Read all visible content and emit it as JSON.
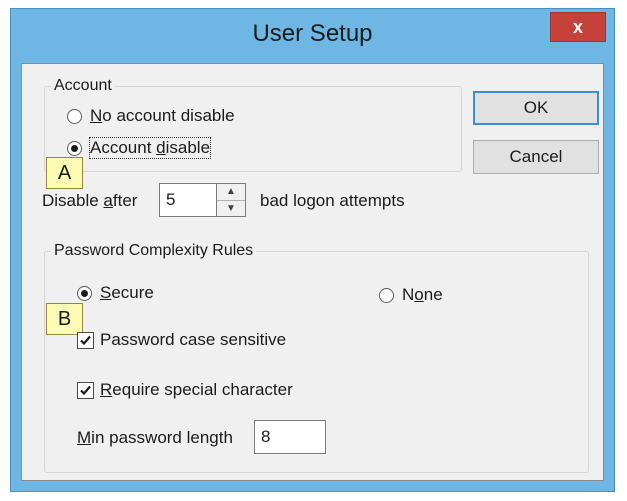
{
  "window": {
    "title": "User Setup",
    "close_glyph": "x"
  },
  "account": {
    "legend": "Account",
    "no_disable": {
      "mnemonic": "N",
      "rest": "o account disable",
      "selected": false
    },
    "disable": {
      "mnemonic": "",
      "pre": "Account ",
      "mn": "d",
      "rest": "isable",
      "selected": true
    },
    "disable_after_pre": "Disable ",
    "disable_after_mn": "a",
    "disable_after_rest": "fter",
    "attempts_value": "5",
    "attempts_suffix": "bad logon attempts"
  },
  "buttons": {
    "ok": "OK",
    "cancel": "Cancel"
  },
  "password": {
    "legend": "Password Complexity Rules",
    "secure": {
      "mn": "S",
      "rest": "ecure",
      "selected": true
    },
    "none": {
      "pre": "N",
      "mn": "o",
      "rest": "ne",
      "selected": false
    },
    "case_sensitive": {
      "label": "Password case sensitive",
      "checked": true
    },
    "special_char": {
      "mn": "R",
      "rest": "equire special character",
      "checked": true
    },
    "min_length_mn": "M",
    "min_length_rest": "in password length",
    "min_length_value": "8"
  },
  "callouts": {
    "a": "A",
    "b": "B"
  },
  "colors": {
    "titlebar": "#6eb6e4",
    "close": "#c7413b",
    "callout": "#fbfbb4",
    "dialog_bg": "#f0f0f0",
    "default_button_border": "#3c8ed4"
  },
  "icons": {
    "close": "close-icon",
    "spin_up": "chevron-up-icon",
    "spin_down": "chevron-down-icon",
    "check": "checkmark-icon"
  }
}
